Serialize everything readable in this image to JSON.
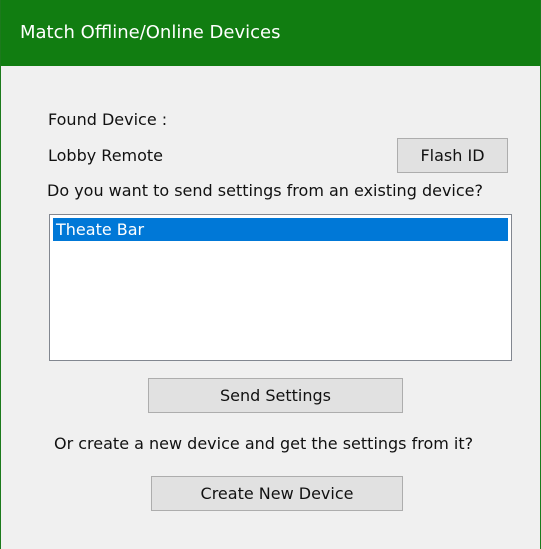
{
  "window": {
    "title": "Match Offline/Online Devices",
    "titlebar_color": "#117d11"
  },
  "found_device": {
    "label": "Found Device :",
    "name": "Lobby Remote",
    "flash_button_label": "Flash ID"
  },
  "question": "Do you want to send settings from an existing device?",
  "device_list": {
    "items": [
      {
        "label": "Theate Bar",
        "selected": true
      }
    ],
    "selection_color": "#0078d7"
  },
  "send_button_label": "Send Settings",
  "create_prompt": "Or create a new device and get the settings from it?",
  "create_button_label": "Create New Device"
}
